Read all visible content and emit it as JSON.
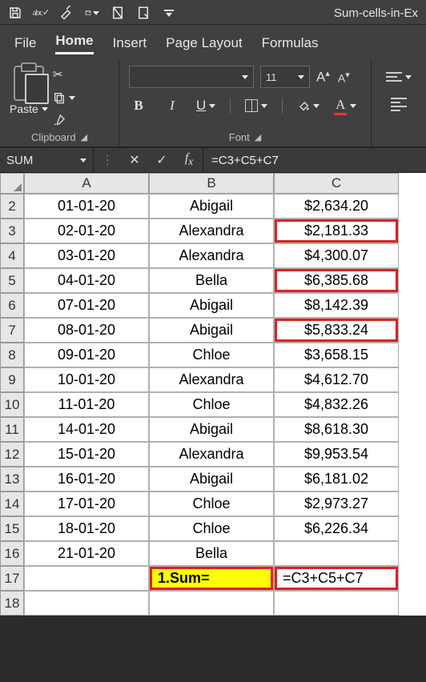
{
  "window": {
    "title": "Sum-cells-in-Ex"
  },
  "tabs": {
    "file": "File",
    "home": "Home",
    "insert": "Insert",
    "pagelayout": "Page Layout",
    "formulas": "Formulas"
  },
  "ribbon": {
    "clipboard": {
      "paste": "Paste",
      "group_label": "Clipboard"
    },
    "font": {
      "font_name": "",
      "font_size": "11",
      "bold": "B",
      "italic": "I",
      "underline": "U",
      "grow": "A",
      "shrink": "A",
      "fontcolor_letter": "A",
      "group_label": "Font"
    }
  },
  "namebox": {
    "value": "SUM"
  },
  "formula_bar": {
    "value": "=C3+C5+C7"
  },
  "columns": [
    "A",
    "B",
    "C"
  ],
  "rows": [
    {
      "n": "2",
      "a": "01-01-20",
      "b": "Abigail",
      "c": "$2,634.20"
    },
    {
      "n": "3",
      "a": "02-01-20",
      "b": "Alexandra",
      "c": "$2,181.33",
      "mark": true
    },
    {
      "n": "4",
      "a": "03-01-20",
      "b": "Alexandra",
      "c": "$4,300.07"
    },
    {
      "n": "5",
      "a": "04-01-20",
      "b": "Bella",
      "c": "$6,385.68",
      "mark": true
    },
    {
      "n": "6",
      "a": "07-01-20",
      "b": "Abigail",
      "c": "$8,142.39"
    },
    {
      "n": "7",
      "a": "08-01-20",
      "b": "Abigail",
      "c": "$5,833.24",
      "mark": true
    },
    {
      "n": "8",
      "a": "09-01-20",
      "b": "Chloe",
      "c": "$3,658.15"
    },
    {
      "n": "9",
      "a": "10-01-20",
      "b": "Alexandra",
      "c": "$4,612.70"
    },
    {
      "n": "10",
      "a": "11-01-20",
      "b": "Chloe",
      "c": "$4,832.26"
    },
    {
      "n": "11",
      "a": "14-01-20",
      "b": "Abigail",
      "c": "$8,618.30"
    },
    {
      "n": "12",
      "a": "15-01-20",
      "b": "Alexandra",
      "c": "$9,953.54"
    },
    {
      "n": "13",
      "a": "16-01-20",
      "b": "Abigail",
      "c": "$6,181.02"
    },
    {
      "n": "14",
      "a": "17-01-20",
      "b": "Chloe",
      "c": "$2,973.27"
    },
    {
      "n": "15",
      "a": "18-01-20",
      "b": "Chloe",
      "c": "$6,226.34"
    },
    {
      "n": "16",
      "a": "21-01-20",
      "b": "Bella",
      "c": ""
    }
  ],
  "sum_row": {
    "n": "17",
    "b": "1.Sum=",
    "c": "=C3+C5+C7"
  },
  "empty_row": {
    "n": "18"
  }
}
